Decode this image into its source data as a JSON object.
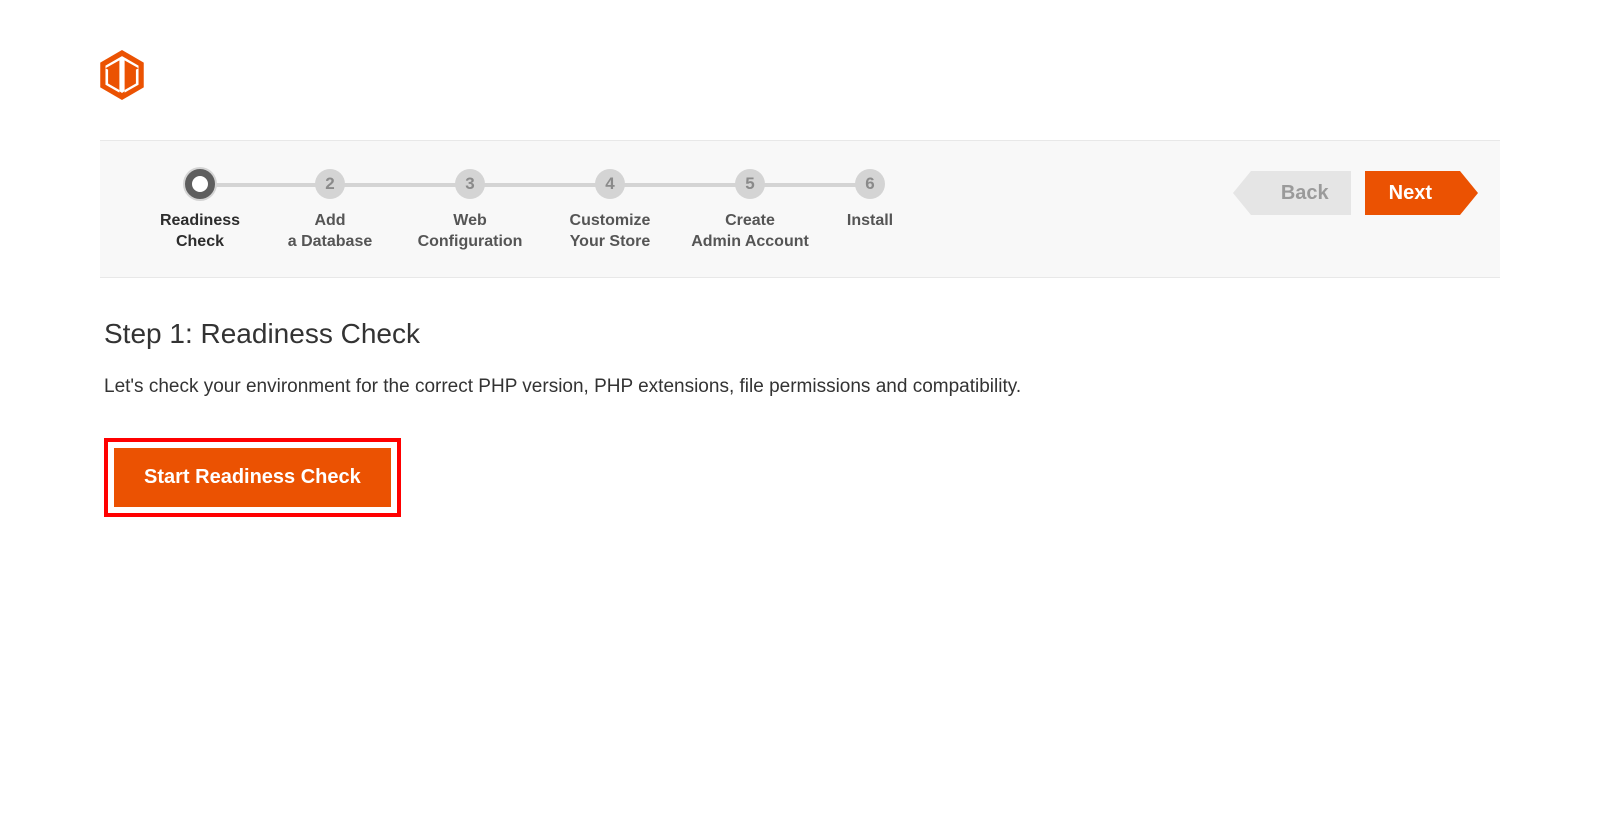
{
  "brand": {
    "accent": "#eb5202"
  },
  "wizard": {
    "steps": [
      {
        "num": "",
        "label": "Readiness\nCheck",
        "active": true
      },
      {
        "num": "2",
        "label": "Add\na Database",
        "active": false
      },
      {
        "num": "3",
        "label": "Web\nConfiguration",
        "active": false
      },
      {
        "num": "4",
        "label": "Customize\nYour Store",
        "active": false
      },
      {
        "num": "5",
        "label": "Create\nAdmin Account",
        "active": false
      },
      {
        "num": "6",
        "label": "Install",
        "active": false
      }
    ],
    "back_label": "Back",
    "next_label": "Next"
  },
  "content": {
    "heading": "Step 1: Readiness Check",
    "description": "Let's check your environment for the correct PHP version, PHP extensions, file permissions and compatibility.",
    "start_button": "Start Readiness Check"
  }
}
